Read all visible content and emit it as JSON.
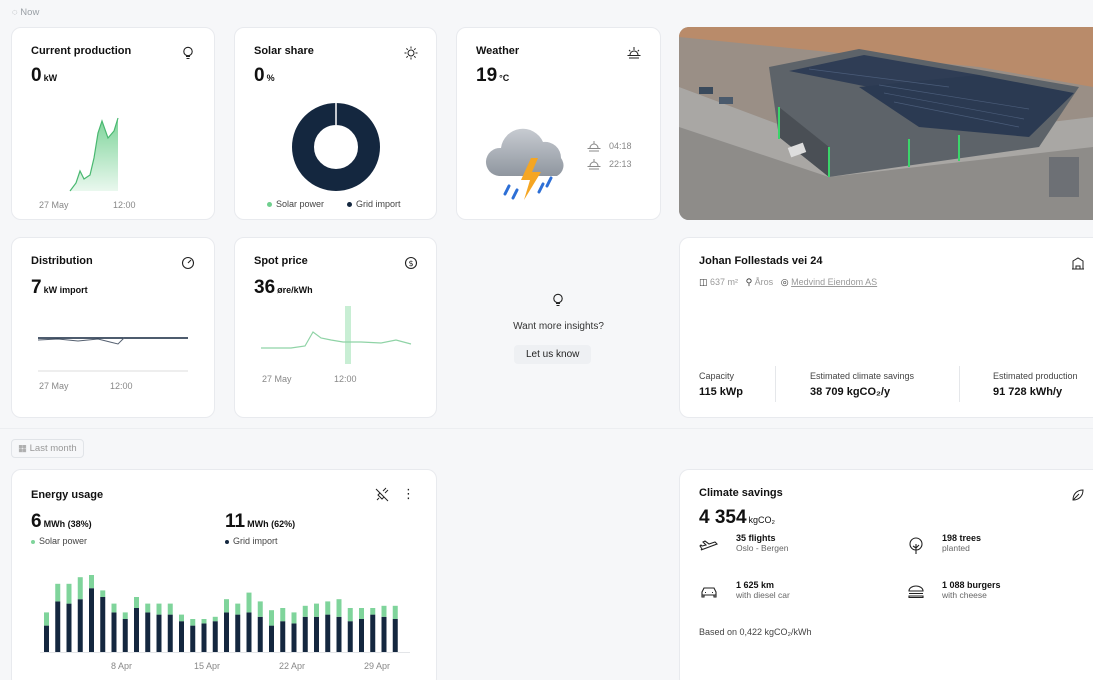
{
  "now_label": "Now",
  "last_month_label": "Last month",
  "production": {
    "title": "Current production",
    "value": "0",
    "unit": "kW",
    "x_labels": [
      "27 May",
      "12:00"
    ],
    "color": "#6fcf8e"
  },
  "solar_share": {
    "title": "Solar share",
    "value": "0",
    "unit": "%",
    "legend_solar": "Solar power",
    "legend_grid": "Grid import",
    "solar_fraction": 0.0,
    "color_grid": "#14273f",
    "color_solar": "#6fcf8e"
  },
  "weather": {
    "title": "Weather",
    "value": "19",
    "unit": "°C",
    "sunrise": "04:18",
    "sunset": "22:13"
  },
  "distribution": {
    "title": "Distribution",
    "value": "7",
    "unit": "kW import",
    "x_labels": [
      "27 May",
      "12:00"
    ]
  },
  "spot_price": {
    "title": "Spot price",
    "value": "36",
    "unit": "øre/kWh",
    "x_labels": [
      "27 May",
      "12:00"
    ]
  },
  "insights": {
    "text": "Want more insights?",
    "button": "Let us know"
  },
  "building": {
    "address": "Johan Follestads vei 24",
    "area": "637 m²",
    "location": "Åros",
    "owner": "Medvind Eiendom AS",
    "stats": [
      {
        "label": "Capacity",
        "value": "115 kWp"
      },
      {
        "label": "Estimated climate savings",
        "value": "38 709 kgCO₂/y"
      },
      {
        "label": "Estimated production",
        "value": "91 728 kWh/y"
      }
    ]
  },
  "energy_usage": {
    "title": "Energy usage",
    "solar_value": "6",
    "solar_unit": "MWh (38%)",
    "solar_label": "Solar power",
    "grid_value": "11",
    "grid_unit": "MWh (62%)",
    "grid_label": "Grid import",
    "x_labels": [
      "8 Apr",
      "15 Apr",
      "22 Apr",
      "29 Apr"
    ],
    "color_solar": "#7fd49b",
    "color_grid": "#14273f"
  },
  "climate": {
    "title": "Climate savings",
    "value": "4 354",
    "unit": "kgCO₂",
    "items": [
      {
        "title": "35 flights",
        "sub": "Oslo - Bergen"
      },
      {
        "title": "198 trees",
        "sub": "planted"
      },
      {
        "title": "1 625 km",
        "sub": "with diesel car"
      },
      {
        "title": "1 088 burgers",
        "sub": "with cheese"
      }
    ],
    "note": "Based on 0,422 kgCO₂/kWh"
  },
  "chart_data": {
    "type": "bar",
    "x_tick_labels": [
      "8 Apr",
      "15 Apr",
      "22 Apr",
      "29 Apr"
    ],
    "series": [
      {
        "name": "Grid import",
        "values": [
          12,
          23,
          22,
          24,
          29,
          25,
          18,
          15,
          20,
          18,
          17,
          17,
          14,
          12,
          13,
          14,
          18,
          17,
          18,
          16,
          12,
          14,
          13,
          16,
          16,
          17,
          16,
          14,
          15,
          17,
          16,
          15
        ]
      },
      {
        "name": "Solar power",
        "values": [
          6,
          8,
          9,
          10,
          6,
          3,
          4,
          3,
          5,
          4,
          5,
          5,
          3,
          3,
          2,
          2,
          6,
          5,
          9,
          7,
          7,
          6,
          5,
          5,
          6,
          6,
          8,
          6,
          5,
          3,
          5,
          6
        ]
      }
    ]
  }
}
